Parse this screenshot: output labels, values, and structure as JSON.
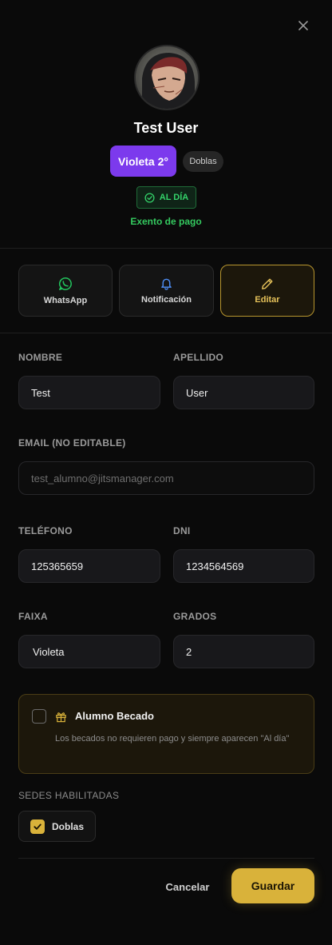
{
  "header": {
    "user_name": "Test User",
    "belt_badge": "Violeta 2°",
    "sede_chip": "Doblas",
    "status_badge": "AL DÍA",
    "payment_note": "Exento de pago"
  },
  "actions": {
    "whatsapp": "WhatsApp",
    "notificacion": "Notificación",
    "editar": "Editar"
  },
  "form": {
    "nombre_label": "NOMBRE",
    "nombre_value": "Test",
    "apellido_label": "APELLIDO",
    "apellido_value": "User",
    "email_label": "EMAIL (NO EDITABLE)",
    "email_value": "test_alumno@jitsmanager.com",
    "telefono_label": "TELÉFONO",
    "telefono_value": "125365659",
    "dni_label": "DNI",
    "dni_value": "1234564569",
    "faixa_label": "FAIXA",
    "faixa_value": "Violeta",
    "grados_label": "GRADOS",
    "grados_value": "2"
  },
  "becado": {
    "title": "Alumno Becado",
    "description": "Los becados no requieren pago y siempre aparecen \"Al día\"",
    "checked": false
  },
  "sedes": {
    "label": "SEDES HABILITADAS",
    "items": [
      {
        "label": "Doblas",
        "checked": true
      }
    ]
  },
  "footer": {
    "cancel": "Cancelar",
    "save": "Guardar"
  },
  "colors": {
    "accent_gold": "#d9b23a",
    "belt_violet": "#7c3aed",
    "status_green": "#34d36a"
  }
}
